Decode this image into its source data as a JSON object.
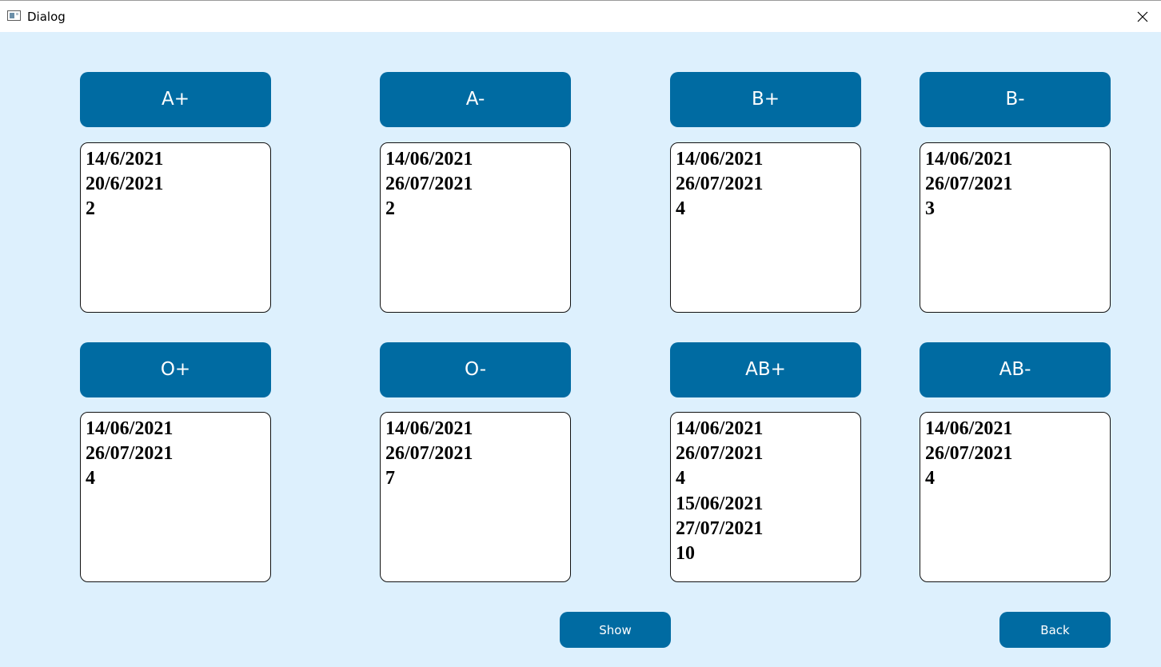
{
  "window": {
    "title": "Dialog",
    "icon": "app-window-icon",
    "close_icon": "close-icon"
  },
  "groups": [
    {
      "label": "A+",
      "lines": [
        "14/6/2021",
        "20/6/2021",
        "2"
      ]
    },
    {
      "label": "A-",
      "lines": [
        "14/06/2021",
        "26/07/2021",
        "2"
      ]
    },
    {
      "label": "B+",
      "lines": [
        "14/06/2021",
        "26/07/2021",
        "4"
      ]
    },
    {
      "label": "B-",
      "lines": [
        "14/06/2021",
        "26/07/2021",
        "3"
      ]
    },
    {
      "label": "O+",
      "lines": [
        "14/06/2021",
        "26/07/2021",
        "4"
      ]
    },
    {
      "label": "O-",
      "lines": [
        "14/06/2021",
        "26/07/2021",
        "7"
      ]
    },
    {
      "label": "AB+",
      "lines": [
        "14/06/2021",
        "26/07/2021",
        "4",
        "15/06/2021",
        "27/07/2021",
        "10"
      ]
    },
    {
      "label": "AB-",
      "lines": [
        "14/06/2021",
        "26/07/2021",
        "4"
      ]
    }
  ],
  "buttons": {
    "show_label": "Show",
    "back_label": "Back"
  },
  "colors": {
    "background": "#ddf0fd",
    "button": "#006ba2",
    "button_text": "#ffffff",
    "box_border": "#111111"
  }
}
